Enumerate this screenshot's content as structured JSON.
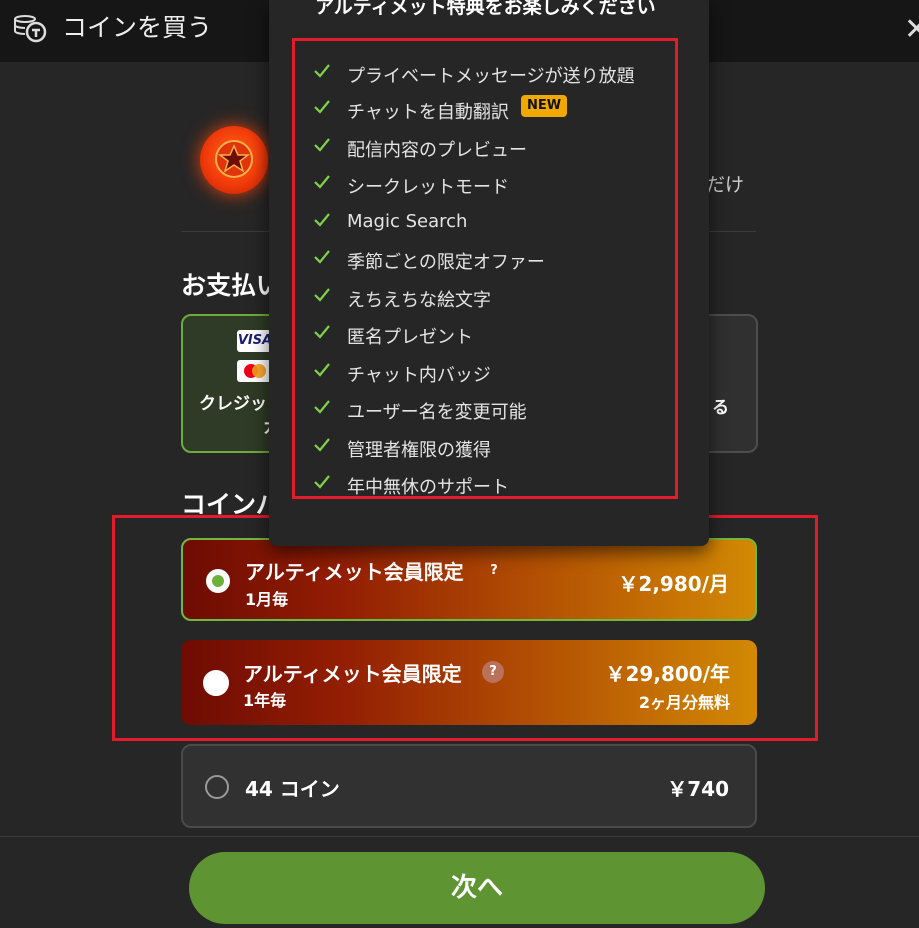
{
  "header": {
    "title": "コインを買う",
    "close_label": "✕"
  },
  "promo": {
    "tail_text": "だけ"
  },
  "payment": {
    "section_label": "お支払い",
    "credit": {
      "card_brand": "VISA",
      "label_line1": "クレジットカード",
      "label_line2": "カ"
    },
    "other": {
      "label_tail": "る"
    }
  },
  "coins_section": {
    "label": "コインパック"
  },
  "plans": [
    {
      "name": "アルティメット会員限定",
      "period": "1月毎",
      "price": "￥2,980/月",
      "help": "?",
      "selected": true
    },
    {
      "name": "アルティメット会員限定",
      "period": "1年毎",
      "price": "￥29,800/年",
      "note": "2ヶ月分無料",
      "help": "?",
      "selected": false
    },
    {
      "name": "44 コイン",
      "price": "￥740",
      "selected": false
    }
  ],
  "next_button": {
    "label": "次へ"
  },
  "popover": {
    "title": "アルティメット特典をお楽しみください",
    "badge_new": "NEW",
    "features": [
      "プライベートメッセージが送り放題",
      "チャットを自動翻訳",
      "配信内容のプレビュー",
      "シークレットモード",
      "Magic Search",
      "季節ごとの限定オファー",
      "えちえちな絵文字",
      "匿名プレゼント",
      "チャット内バッジ",
      "ユーザー名を変更可能",
      "管理者権限の獲得",
      "年中無休のサポート"
    ]
  },
  "colors": {
    "accent_green": "#5e9432",
    "highlight_red": "#e21c2a",
    "new_badge": "#f1a800"
  }
}
